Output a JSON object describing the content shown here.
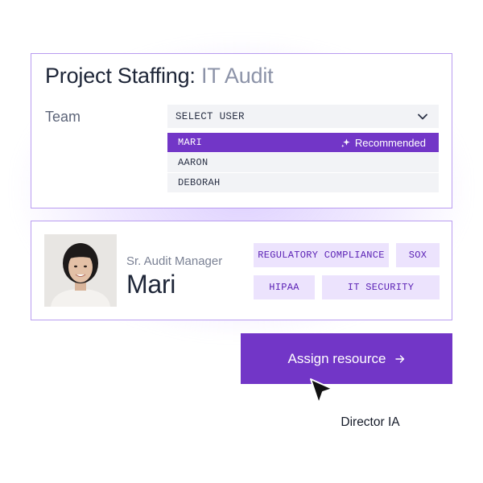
{
  "project": {
    "title_prefix": "Project Staffing: ",
    "title_accent": "IT Audit",
    "team_label": "Team",
    "select_placeholder": "SELECT USER",
    "options": [
      {
        "label": "MARI",
        "badge": "Recommended",
        "selected": true
      },
      {
        "label": "AARON"
      },
      {
        "label": "DEBORAH"
      }
    ]
  },
  "profile": {
    "role": "Sr. Audit Manager",
    "name": "Mari",
    "tags": [
      "REGULATORY COMPLIANCE",
      "SOX",
      "HIPAA",
      "IT SECURITY"
    ]
  },
  "assign_button": {
    "label": "Assign resource",
    "icon": "arrow-right-icon"
  },
  "cursor": {
    "label": "Director IA",
    "icon": "pointer-cursor-icon"
  },
  "colors": {
    "accent": "#7236c7",
    "tag_bg": "#ece3fd",
    "tag_text": "#5b22b5",
    "card_border": "#b99cf0"
  }
}
